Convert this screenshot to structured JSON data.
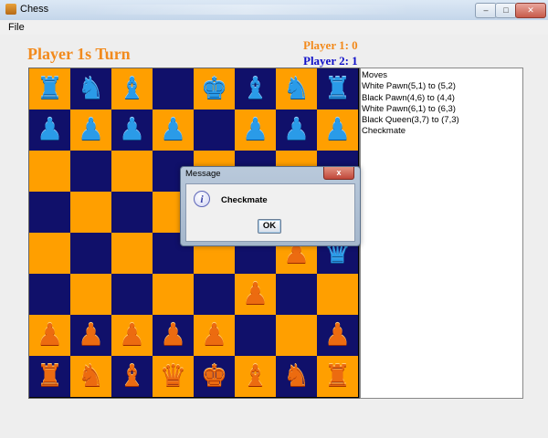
{
  "window": {
    "title": "Chess",
    "controls": [
      "–",
      "□",
      "✕"
    ]
  },
  "menu": {
    "file": "File"
  },
  "status": {
    "turn": "Player 1s Turn",
    "player1_score": "Player 1: 0",
    "player2_score": "Player 2: 1"
  },
  "colors": {
    "orange_square": "#ff9f00",
    "navy_square": "#10106a",
    "turn_text": "#f28a1c",
    "player2_text": "#1010c8"
  },
  "board": [
    [
      {
        "piece": "rook",
        "side": "blue"
      },
      {
        "piece": "knight",
        "side": "blue"
      },
      {
        "piece": "bishop",
        "side": "blue"
      },
      null,
      {
        "piece": "king",
        "side": "blue"
      },
      {
        "piece": "bishop",
        "side": "blue"
      },
      {
        "piece": "knight",
        "side": "blue"
      },
      {
        "piece": "rook",
        "side": "blue"
      }
    ],
    [
      {
        "piece": "pawn",
        "side": "blue"
      },
      {
        "piece": "pawn",
        "side": "blue"
      },
      {
        "piece": "pawn",
        "side": "blue"
      },
      {
        "piece": "pawn",
        "side": "blue"
      },
      null,
      {
        "piece": "pawn",
        "side": "blue"
      },
      {
        "piece": "pawn",
        "side": "blue"
      },
      {
        "piece": "pawn",
        "side": "blue"
      }
    ],
    [
      null,
      null,
      null,
      null,
      null,
      null,
      null,
      null
    ],
    [
      null,
      null,
      null,
      null,
      {
        "piece": "pawn",
        "side": "blue"
      },
      null,
      null,
      null
    ],
    [
      null,
      null,
      null,
      null,
      null,
      null,
      {
        "piece": "pawn",
        "side": "orange"
      },
      {
        "piece": "queen",
        "side": "blue"
      }
    ],
    [
      null,
      null,
      null,
      null,
      null,
      {
        "piece": "pawn",
        "side": "orange"
      },
      null,
      null
    ],
    [
      {
        "piece": "pawn",
        "side": "orange"
      },
      {
        "piece": "pawn",
        "side": "orange"
      },
      {
        "piece": "pawn",
        "side": "orange"
      },
      {
        "piece": "pawn",
        "side": "orange"
      },
      {
        "piece": "pawn",
        "side": "orange"
      },
      null,
      null,
      {
        "piece": "pawn",
        "side": "orange"
      }
    ],
    [
      {
        "piece": "rook",
        "side": "orange"
      },
      {
        "piece": "knight",
        "side": "orange"
      },
      {
        "piece": "bishop",
        "side": "orange"
      },
      {
        "piece": "queen",
        "side": "orange"
      },
      {
        "piece": "king",
        "side": "orange"
      },
      {
        "piece": "bishop",
        "side": "orange"
      },
      {
        "piece": "knight",
        "side": "orange"
      },
      {
        "piece": "rook",
        "side": "orange"
      }
    ]
  ],
  "moves": {
    "header": "Moves",
    "list": [
      "White Pawn(5,1) to (5,2)",
      "Black Pawn(4,6) to (4,4)",
      "White Pawn(6,1) to (6,3)",
      "Black Queen(3,7) to (7,3)",
      "Checkmate"
    ]
  },
  "dialog": {
    "title": "Message",
    "close": "x",
    "icon": "info-icon",
    "message": "Checkmate",
    "ok": "OK"
  }
}
